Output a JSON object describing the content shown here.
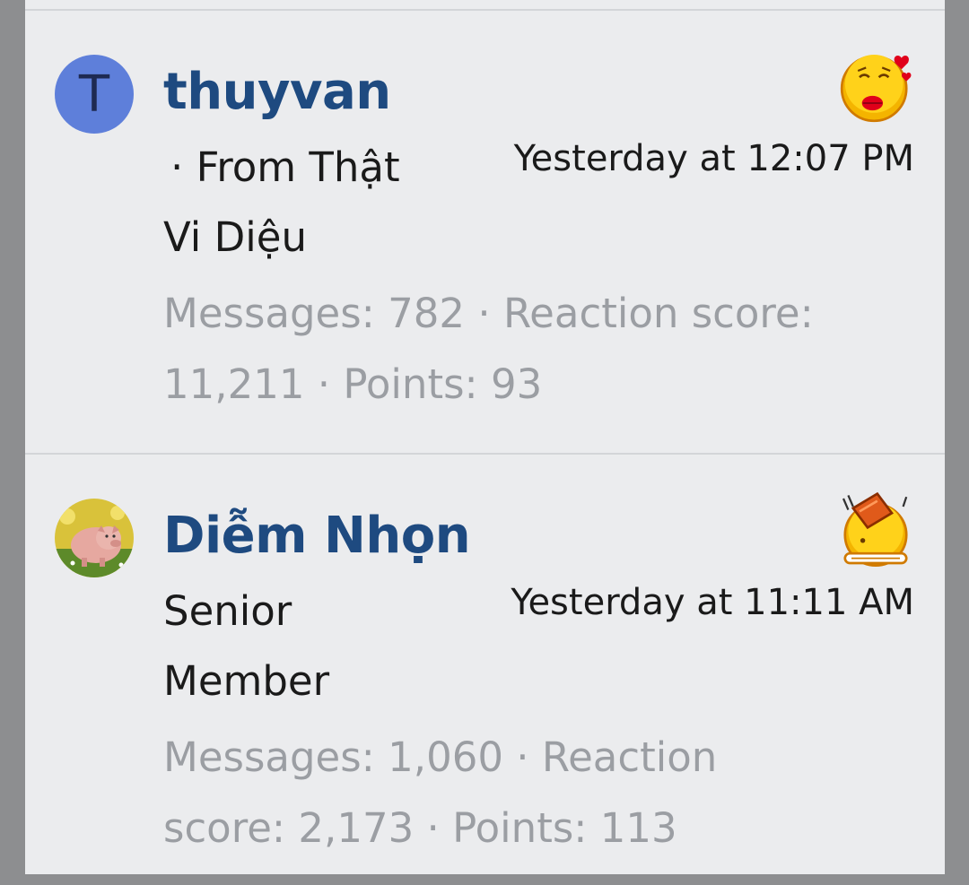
{
  "posts": [
    {
      "username": "thuyvan",
      "avatar_letter": "T",
      "user_title_line1": "· From Thật",
      "user_title_line2": "Vi Diệu",
      "timestamp": "Yesterday at 12:07 PM",
      "stats_line1": "Messages: 782 · Reaction score:",
      "stats_line2": "11,211 · Points: 93",
      "reaction_icon": "kiss-emoji-icon"
    },
    {
      "username": "Diễm Nhọn",
      "avatar_icon": "pig-avatar",
      "user_title_line1": "Senior",
      "user_title_line2": "Member",
      "timestamp": "Yesterday at 11:11 AM",
      "stats_line1": "Messages: 1,060 · Reaction",
      "stats_line2": "score: 2,173 · Points: 113",
      "reaction_icon": "brick-hit-emoji-icon"
    }
  ],
  "colors": {
    "username": "#1e4a80",
    "avatar_bg": "#5e7fda",
    "stats_text": "#9b9ea3",
    "panel_bg": "#ebecee"
  }
}
